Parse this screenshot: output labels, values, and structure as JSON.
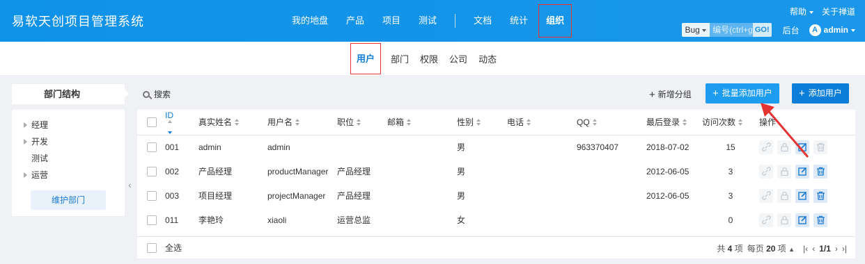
{
  "header": {
    "brand": "易软天创项目管理系统",
    "nav": [
      "我的地盘",
      "产品",
      "项目",
      "测试",
      "文档",
      "统计"
    ],
    "nav_active": "组织",
    "help": "帮助",
    "about": "关于禅道",
    "search_type": "Bug",
    "search_placeholder": "编号(ctrl+g",
    "go": "GO!",
    "backend": "后台",
    "user_initial": "A",
    "user_name": "admin"
  },
  "subnav": {
    "active": "用户",
    "items": [
      "部门",
      "权限",
      "公司",
      "动态"
    ]
  },
  "sidebar": {
    "title": "部门结构",
    "tree": [
      {
        "label": "经理",
        "has_children": true
      },
      {
        "label": "开发",
        "has_children": true
      },
      {
        "label": "测试",
        "has_children": false
      },
      {
        "label": "运营",
        "has_children": true
      }
    ],
    "maintain_button": "维护部门"
  },
  "toolbar": {
    "search": "搜索",
    "add_group": "新增分组",
    "batch_add": "批量添加用户",
    "add_user": "添加用户"
  },
  "table": {
    "columns": [
      "ID",
      "真实姓名",
      "用户名",
      "职位",
      "邮箱",
      "性别",
      "电话",
      "QQ",
      "最后登录",
      "访问次数",
      "操作"
    ],
    "rows": [
      {
        "id": "001",
        "realname": "admin",
        "account": "admin",
        "role": "",
        "email": "",
        "gender": "男",
        "phone": "",
        "qq": "963370407",
        "last": "2018-07-02",
        "visits": "15"
      },
      {
        "id": "002",
        "realname": "产品经理",
        "account": "productManager",
        "role": "产品经理",
        "email": "",
        "gender": "男",
        "phone": "",
        "qq": "",
        "last": "2012-06-05",
        "visits": "3"
      },
      {
        "id": "003",
        "realname": "项目经理",
        "account": "projectManager",
        "role": "产品经理",
        "email": "",
        "gender": "男",
        "phone": "",
        "qq": "",
        "last": "2012-06-05",
        "visits": "3"
      },
      {
        "id": "011",
        "realname": "李艳玲",
        "account": "xiaoli",
        "role": "运营总监",
        "email": "",
        "gender": "女",
        "phone": "",
        "qq": "",
        "last": "",
        "visits": "0"
      }
    ],
    "select_all": "全选"
  },
  "pager": {
    "total_prefix": "共",
    "total": "4",
    "total_suffix": "项",
    "per_page_prefix": "每页",
    "per_page": "20",
    "per_page_suffix": "项",
    "page": "1/1"
  },
  "colors": {
    "accent": "#0c7ed9",
    "header_bg": "#1a97ea",
    "highlight": "#e33333"
  }
}
